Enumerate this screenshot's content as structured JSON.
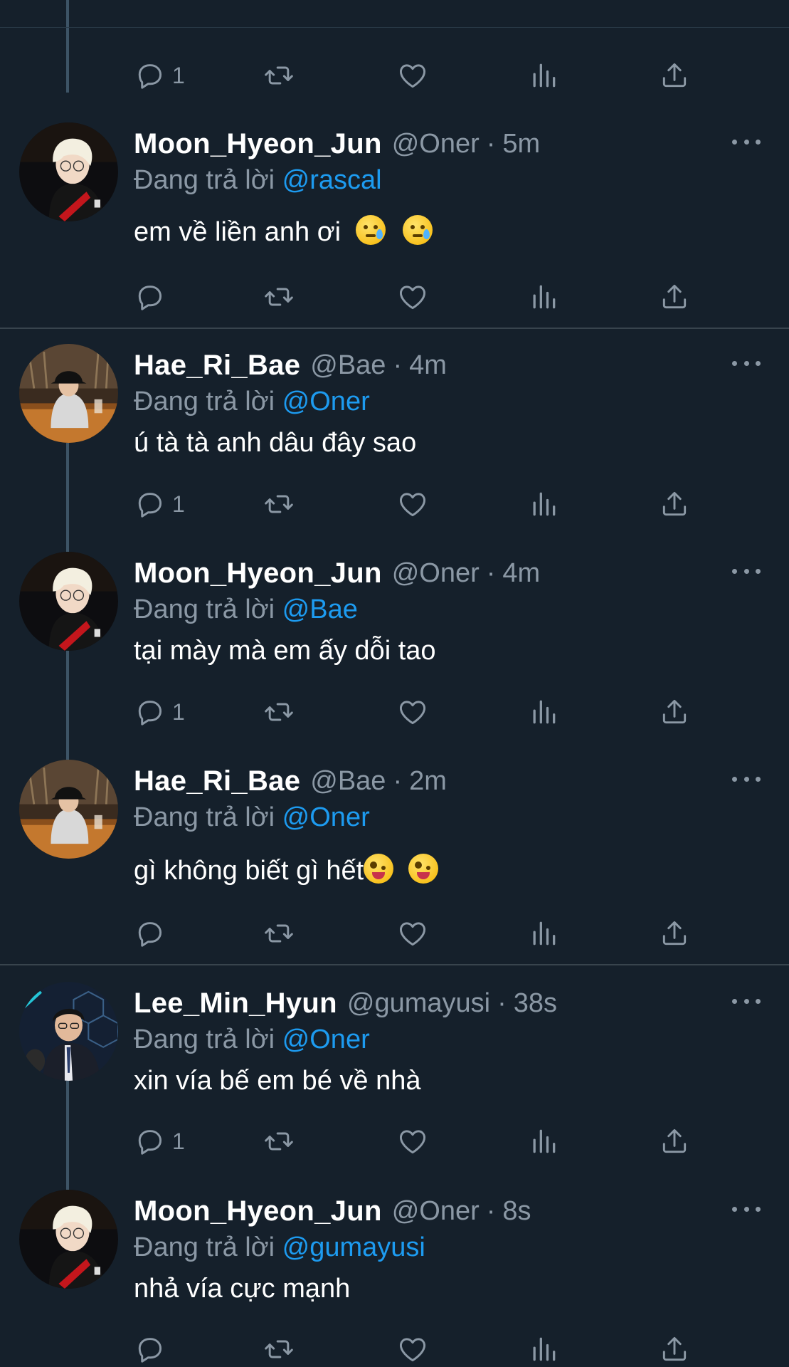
{
  "colors": {
    "background": "#15202b",
    "secondary_text": "#8b98a5",
    "link": "#1d9bf0",
    "divider": "#38444d",
    "thread_line": "#3d5466"
  },
  "icons": {
    "reply": "reply-icon",
    "retweet": "retweet-icon",
    "like": "heart-icon",
    "views": "views-chart-icon",
    "share": "share-icon",
    "more": "more-dots-icon"
  },
  "partial_tweet": {
    "reply_count": "1"
  },
  "tweets": [
    {
      "display_name": "Moon_Hyeon_Jun",
      "handle": "@Oner",
      "time": "5m",
      "replying_prefix": "Đang trả lời",
      "replying_to": "@rascal",
      "text": "em về liền anh ơi",
      "emoji": [
        "crying-face-emoji",
        "crying-face-emoji"
      ],
      "reply_count": ""
    },
    {
      "display_name": "Hae_Ri_Bae",
      "handle": "@Bae",
      "time": "4m",
      "replying_prefix": "Đang trả lời",
      "replying_to": "@Oner",
      "text": "ú tà tà anh dâu đây sao",
      "reply_count": "1"
    },
    {
      "display_name": "Moon_Hyeon_Jun",
      "handle": "@Oner",
      "time": "4m",
      "replying_prefix": "Đang trả lời",
      "replying_to": "@Bae",
      "text": "tại mày mà em ấy dỗi tao",
      "reply_count": "1"
    },
    {
      "display_name": "Hae_Ri_Bae",
      "handle": "@Bae",
      "time": "2m",
      "replying_prefix": "Đang trả lời",
      "replying_to": "@Oner",
      "text": "gì không biết gì hết",
      "emoji": [
        "zany-face-emoji",
        "zany-face-emoji"
      ],
      "reply_count": ""
    },
    {
      "display_name": "Lee_Min_Hyun",
      "handle": "@gumayusi",
      "time": "38s",
      "replying_prefix": "Đang trả lời",
      "replying_to": "@Oner",
      "text": "xin vía bế em bé về nhà",
      "reply_count": "1"
    },
    {
      "display_name": "Moon_Hyeon_Jun",
      "handle": "@Oner",
      "time": "8s",
      "replying_prefix": "Đang trả lời",
      "replying_to": "@gumayusi",
      "text": "nhả vía cực mạnh",
      "reply_count": ""
    }
  ]
}
